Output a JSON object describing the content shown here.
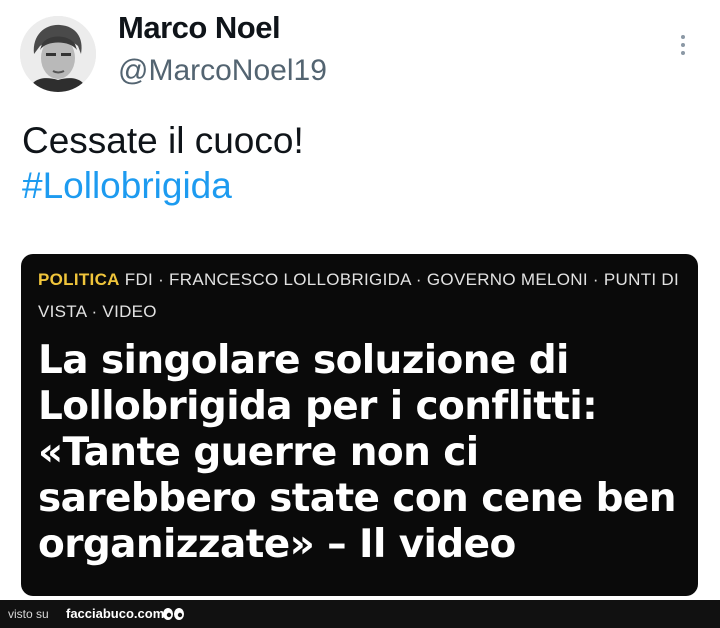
{
  "tweet": {
    "display_name": "Marco Noel",
    "handle": "@MarcoNoel19",
    "text": "Cessate il cuoco!",
    "hashtag": "#Lollobrigida"
  },
  "article": {
    "category": "POLITICA",
    "tags": "FDI · FRANCESCO LOLLOBRIGIDA · GOVERNO MELONI · PUNTI DI VISTA · VIDEO",
    "headline": "La singolare soluzione di Lollobrigida per i conflitti: «Tante guerre non ci sarebbero state con cene ben organizzate» – Il video"
  },
  "footer": {
    "visto_su": "visto su",
    "site": "facciabuco.com"
  },
  "colors": {
    "hashtag": "#1d9bf0",
    "category": "#f0c53b",
    "card_background": "#0a0a0a"
  },
  "icons": {
    "menu": "more-vertical-icon",
    "logo": "eyes-icon"
  }
}
